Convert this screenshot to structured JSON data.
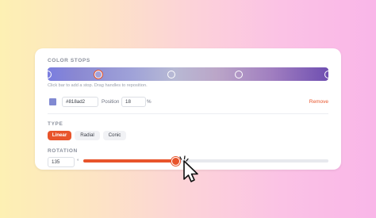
{
  "color_stops": {
    "title": "COLOR STOPS",
    "hint": "Click bar to add a stop. Drag handles to reposition.",
    "stops": [
      {
        "position": 0
      },
      {
        "position": 18,
        "active": true
      },
      {
        "position": 44
      },
      {
        "position": 68
      },
      {
        "position": 100
      }
    ]
  },
  "selected_stop": {
    "color": "#818ad2",
    "position_label": "Position",
    "position_value": "18",
    "unit": "%",
    "remove_label": "Remove"
  },
  "type": {
    "title": "TYPE",
    "options": [
      "Linear",
      "Radial",
      "Conic"
    ],
    "selected": "Linear"
  },
  "rotation": {
    "title": "ROTATION",
    "value": "135",
    "unit": "°",
    "slider_fraction": 0.375
  },
  "colors": {
    "accent": "#e8542b"
  }
}
